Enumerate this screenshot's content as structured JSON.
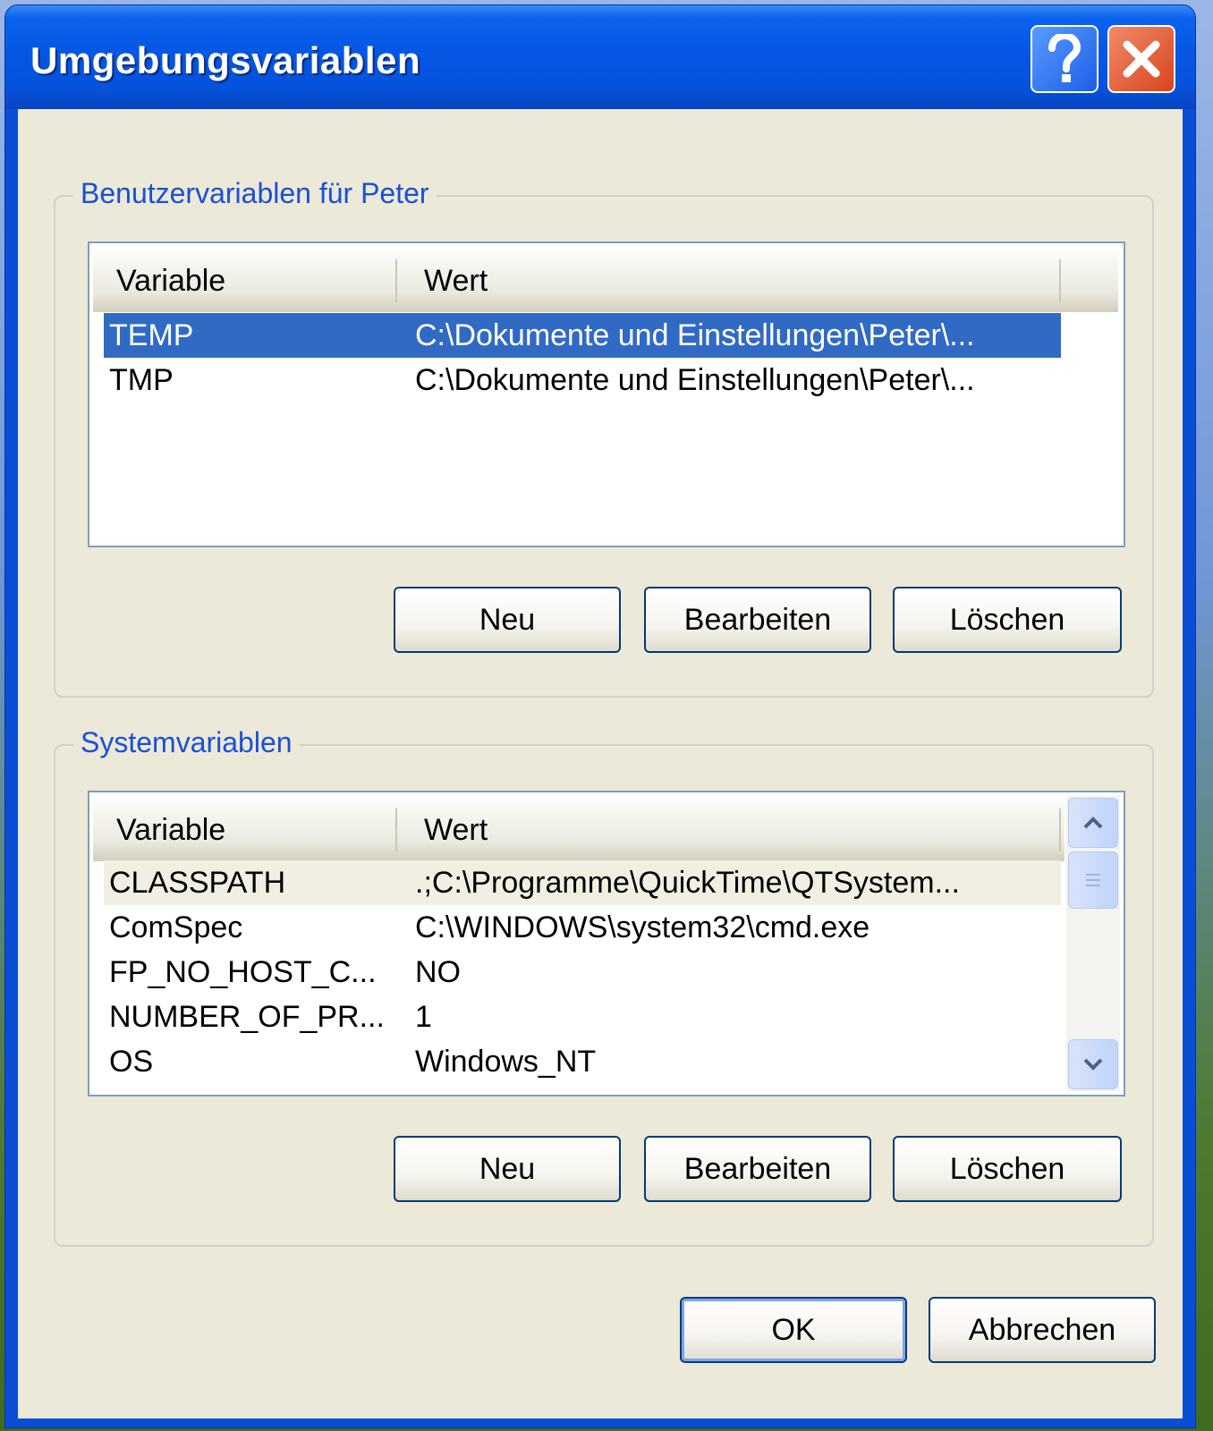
{
  "window": {
    "title": "Umgebungsvariablen"
  },
  "user_group": {
    "label": "Benutzervariablen für Peter",
    "columns": [
      "Variable",
      "Wert"
    ],
    "rows": [
      {
        "variable": "TEMP",
        "value": "C:\\Dokumente und Einstellungen\\Peter\\...",
        "selected": true
      },
      {
        "variable": "TMP",
        "value": "C:\\Dokumente und Einstellungen\\Peter\\..."
      }
    ],
    "buttons": {
      "new": "Neu",
      "edit": "Bearbeiten",
      "delete": "Löschen"
    }
  },
  "system_group": {
    "label": "Systemvariablen",
    "columns": [
      "Variable",
      "Wert"
    ],
    "rows": [
      {
        "variable": "CLASSPATH",
        "value": ".;C:\\Programme\\QuickTime\\QTSystem..."
      },
      {
        "variable": "ComSpec",
        "value": "C:\\WINDOWS\\system32\\cmd.exe"
      },
      {
        "variable": "FP_NO_HOST_C...",
        "value": "NO"
      },
      {
        "variable": "NUMBER_OF_PR...",
        "value": "1"
      },
      {
        "variable": "OS",
        "value": "Windows_NT"
      }
    ],
    "buttons": {
      "new": "Neu",
      "edit": "Bearbeiten",
      "delete": "Löschen"
    }
  },
  "footer": {
    "ok": "OK",
    "cancel": "Abbrechen"
  },
  "colors": {
    "title_bar": "#0556e2",
    "selection": "#316ac5",
    "group_label": "#1b4fd6",
    "dialog_bg": "#ece9d8"
  }
}
